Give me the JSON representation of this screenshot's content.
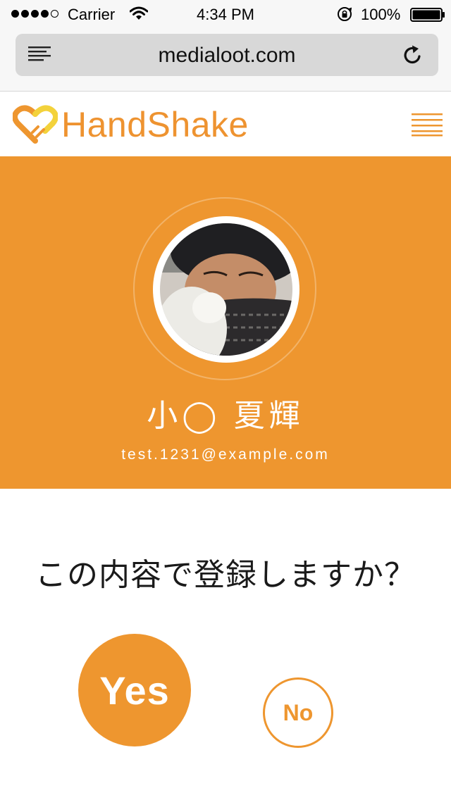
{
  "status_bar": {
    "carrier": "Carrier",
    "time": "4:34 PM",
    "battery": "100%",
    "signal_bars_filled": 4,
    "signal_bars_total": 5
  },
  "browser": {
    "url": "medialoot.com",
    "icons": [
      "reader-icon",
      "reload-icon"
    ]
  },
  "app": {
    "logo_text": "HandShake",
    "brand_color": "#ee962f",
    "icons": [
      "handshake-logo-icon",
      "hamburger-menu-icon"
    ]
  },
  "profile": {
    "name": "小◯ 夏輝",
    "email": "test.1231@example.com"
  },
  "confirm": {
    "question": "この内容で登録しますか？",
    "yes_label": "Yes",
    "no_label": "No"
  }
}
